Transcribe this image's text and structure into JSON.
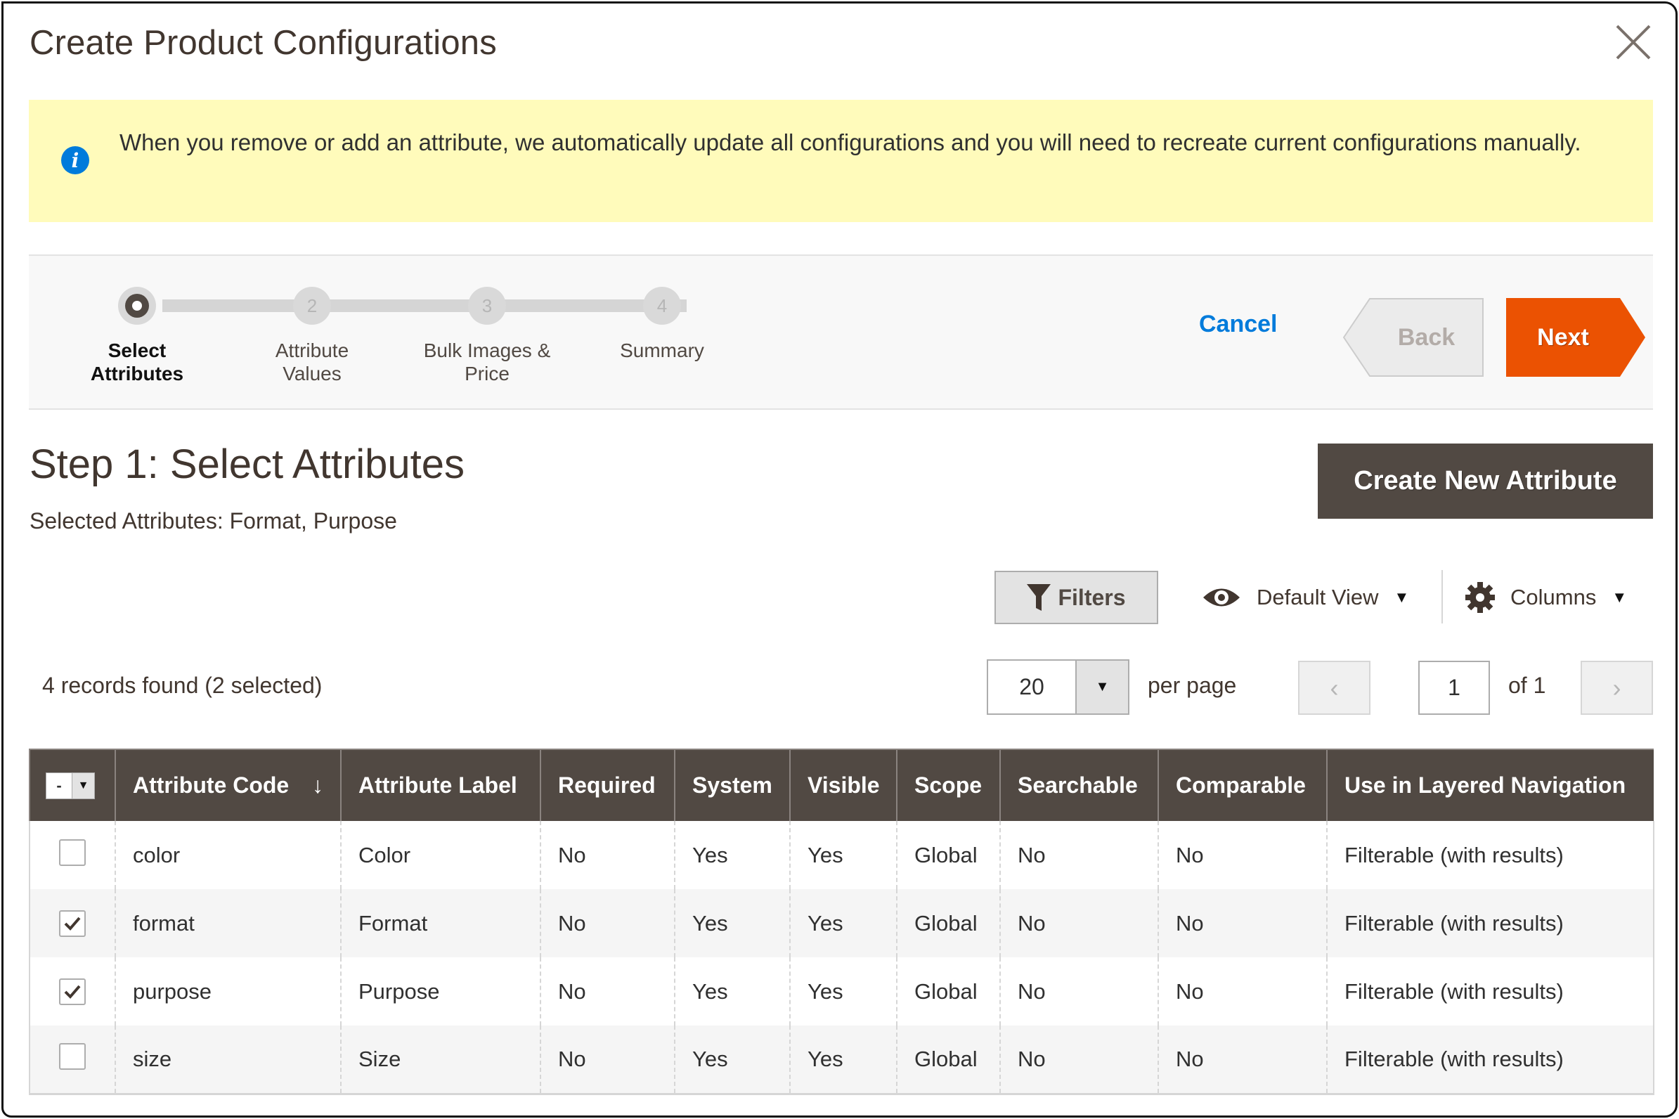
{
  "modal": {
    "title": "Create Product Configurations",
    "close_icon": "close-icon"
  },
  "notice": {
    "icon": "info-icon",
    "icon_glyph": "i",
    "text": "When you remove or add an attribute, we automatically update all configurations and you will need to recreate current configurations manually."
  },
  "wizard": {
    "current_step": 1,
    "steps": [
      {
        "number": "1",
        "label_line1": "Select",
        "label_line2": "Attributes",
        "active": true
      },
      {
        "number": "2",
        "label_line1": "Attribute",
        "label_line2": "Values",
        "active": false
      },
      {
        "number": "3",
        "label_line1": "Bulk Images &",
        "label_line2": "Price",
        "active": false
      },
      {
        "number": "4",
        "label_line1": "Summary",
        "label_line2": "",
        "active": false
      }
    ],
    "cancel_label": "Cancel",
    "back_label": "Back",
    "next_label": "Next"
  },
  "step": {
    "heading": "Step 1: Select Attributes",
    "selected_text": "Selected Attributes: Format, Purpose",
    "create_attribute_label": "Create New Attribute"
  },
  "toolbar": {
    "filters_label": "Filters",
    "view_label": "Default View",
    "columns_label": "Columns"
  },
  "pagination": {
    "records_text": "4 records found (2 selected)",
    "per_page_value": "20",
    "per_page_label": "per page",
    "prev_glyph": "‹",
    "current_page": "1",
    "of_text": "of 1",
    "next_glyph": "›"
  },
  "table": {
    "mass_select_glyph": "-",
    "sort_glyph": "↓",
    "columns": [
      "Attribute Code",
      "Attribute Label",
      "Required",
      "System",
      "Visible",
      "Scope",
      "Searchable",
      "Comparable",
      "Use in Layered Navigation"
    ],
    "rows": [
      {
        "selected": false,
        "cells": [
          "color",
          "Color",
          "No",
          "Yes",
          "Yes",
          "Global",
          "No",
          "No",
          "Filterable (with results)"
        ]
      },
      {
        "selected": true,
        "cells": [
          "format",
          "Format",
          "No",
          "Yes",
          "Yes",
          "Global",
          "No",
          "No",
          "Filterable (with results)"
        ]
      },
      {
        "selected": true,
        "cells": [
          "purpose",
          "Purpose",
          "No",
          "Yes",
          "Yes",
          "Global",
          "No",
          "No",
          "Filterable (with results)"
        ]
      },
      {
        "selected": false,
        "cells": [
          "size",
          "Size",
          "No",
          "Yes",
          "Yes",
          "Global",
          "No",
          "No",
          "Filterable (with results)"
        ]
      }
    ]
  },
  "colors": {
    "accent_orange": "#eb5202",
    "link_blue": "#007bdb",
    "header_brown": "#514943",
    "notice_yellow": "#fffbbb"
  }
}
